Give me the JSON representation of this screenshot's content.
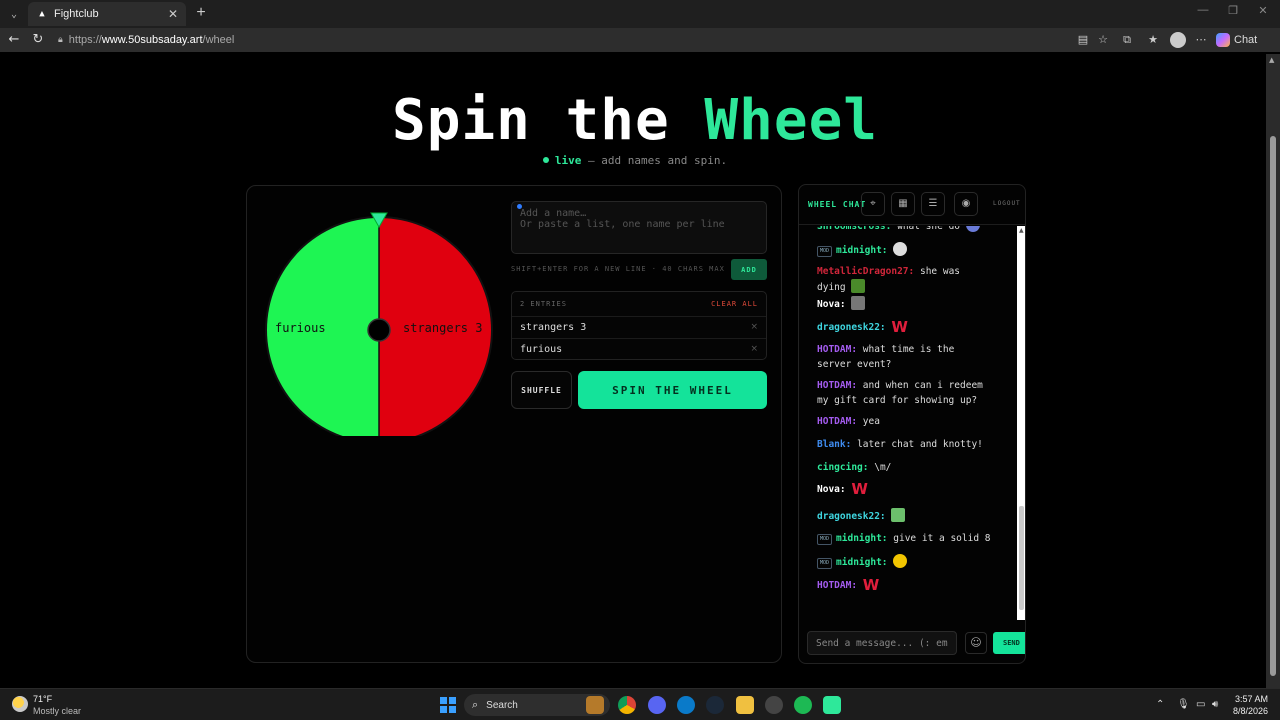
{
  "browser": {
    "tab_title": "Fightclub",
    "tab_close": "✕",
    "new_tab": "+",
    "url_scheme": "https://",
    "url_host": "www.50subsaday.art",
    "url_path": "/wheel",
    "chat_label": "Chat",
    "icons": [
      "back-icon",
      "refresh-icon",
      "lock-icon",
      "reader-icon",
      "favorite-icon",
      "extensions-icon",
      "favorites-icon",
      "profile-icon",
      "more-icon"
    ]
  },
  "hero": {
    "title_main": "Spin the ",
    "title_accent": "Wheel",
    "live_word": "live",
    "subtitle_rest": " — add names and spin."
  },
  "wheel": {
    "segments": [
      {
        "label": "strangers 3",
        "color": "#e0000f"
      },
      {
        "label": "furious",
        "color": "#1ef553"
      }
    ],
    "pointer_color": "#2ee89a"
  },
  "editor": {
    "placeholder": "Add a name…\nOr paste a list, one name per line",
    "hint": "SHIFT+ENTER FOR A NEW LINE · 40 CHARS MAX",
    "add_label": "ADD",
    "entries_count": "2 ENTRIES",
    "clear_all": "CLEAR ALL",
    "entries": [
      {
        "name": "strangers 3"
      },
      {
        "name": "furious"
      }
    ],
    "remove_glyph": "×",
    "shuffle_label": "SHUFFLE",
    "spin_label": "SPIN THE WHEEL"
  },
  "chat": {
    "title": "WHEEL CHAT",
    "logout": "LOGOUT",
    "mod_badge": "MOD",
    "messages": [
      {
        "user": "ShroomsCross:",
        "text": "what she do",
        "color": "#2ee89a",
        "mod": false,
        "emote": "avatar-emote"
      },
      {
        "user": "midnight:",
        "text": "",
        "color": "#2ee89a",
        "mod": true,
        "emote": "moon-emote"
      },
      {
        "user": "MetallicDragon27:",
        "text": "she was dying",
        "color": "#d0263a",
        "mod": false,
        "emote": "pepe-emote"
      },
      {
        "user": "Nova:",
        "text": "",
        "color": "#ffffff",
        "mod": false,
        "emote": "cat-emote"
      },
      {
        "user": "dragonesk22:",
        "text": "",
        "color": "#3fd6e0",
        "mod": false,
        "emote": "w-emote"
      },
      {
        "user": "HOTDAM:",
        "text": "what time is the server event?",
        "color": "#a45cf0",
        "mod": false,
        "emote": ""
      },
      {
        "user": "HOTDAM:",
        "text": "and when can i redeem my gift card for showing up?",
        "color": "#a45cf0",
        "mod": false,
        "emote": ""
      },
      {
        "user": "HOTDAM:",
        "text": "yea",
        "color": "#a45cf0",
        "mod": false,
        "emote": ""
      },
      {
        "user": "Blank:",
        "text": "later chat and knotty!",
        "color": "#3f8cf0",
        "mod": false,
        "emote": ""
      },
      {
        "user": "cingcing:",
        "text": "\\m/",
        "color": "#2ee89a",
        "mod": false,
        "emote": ""
      },
      {
        "user": "Nova:",
        "text": "",
        "color": "#ffffff",
        "mod": false,
        "emote": "w-emote"
      },
      {
        "user": "dragonesk22:",
        "text": "",
        "color": "#3fd6e0",
        "mod": false,
        "emote": "money-emote"
      },
      {
        "user": "midnight:",
        "text": "give it a solid 8",
        "color": "#2ee89a",
        "mod": true,
        "emote": ""
      },
      {
        "user": "midnight:",
        "text": "",
        "color": "#2ee89a",
        "mod": true,
        "emote": "shades-emote"
      },
      {
        "user": "HOTDAM:",
        "text": "",
        "color": "#a45cf0",
        "mod": false,
        "emote": "w-emote"
      }
    ],
    "input_placeholder": "Send a message... (: emo",
    "send_label": "SEND"
  },
  "taskbar": {
    "temp": "71°F",
    "weather": "Mostly clear",
    "search_label": "Search",
    "time": "3:57 AM",
    "date": "8/8/2026"
  }
}
